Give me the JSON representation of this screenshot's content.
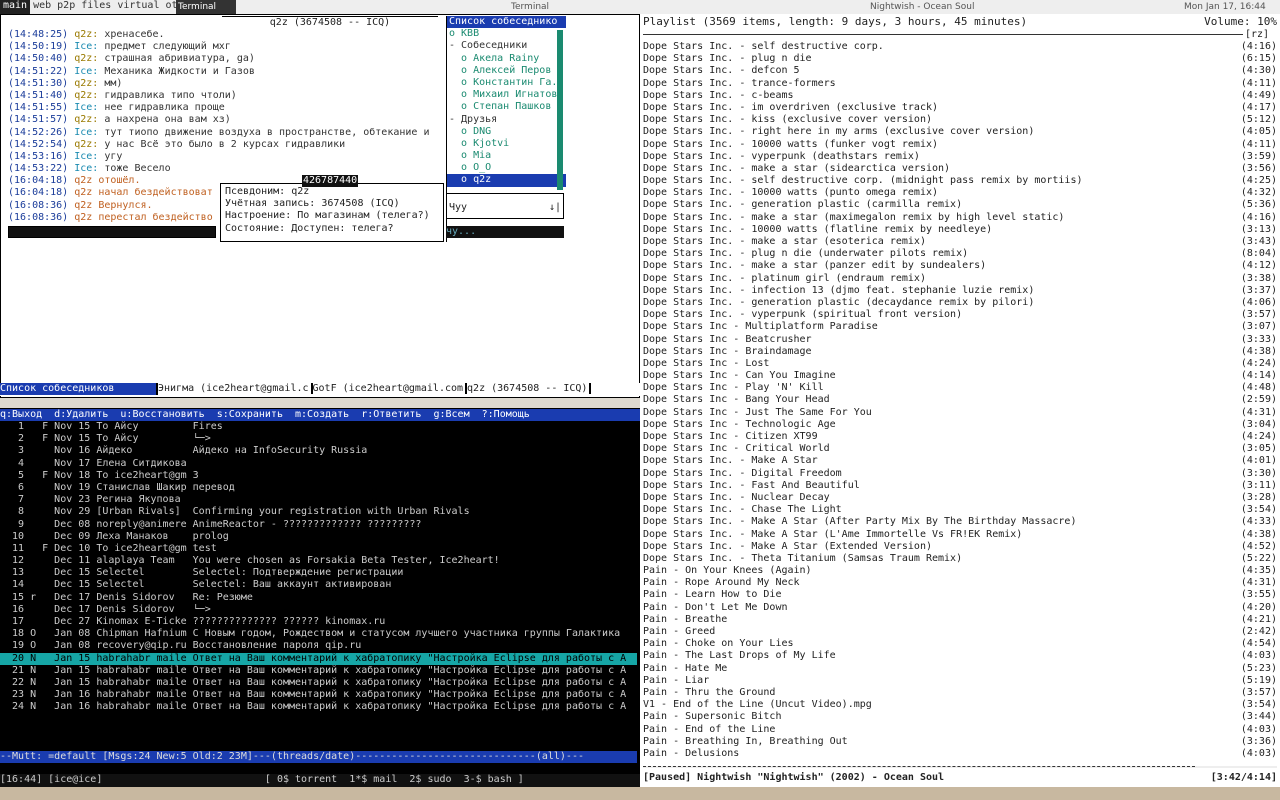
{
  "topbar": {
    "tags": [
      "main",
      "web",
      "p2p",
      "files",
      "virtual",
      "other"
    ],
    "selected_tag": "main",
    "left_window": "Terminal",
    "mid_window": "Terminal",
    "right_window": "Nightwish - Ocean Soul",
    "clock": "Mon Jan 17, 16:44"
  },
  "im": {
    "window_title": "q2z (3674508 -- ICQ)",
    "messages": [
      {
        "time": "(14:48:25)",
        "nick": "q2z:",
        "text": " хренасебе.",
        "type": "q2z"
      },
      {
        "time": "(14:50:19)",
        "nick": "Ice:",
        "text": " предмет следующий мхг",
        "type": "ice"
      },
      {
        "time": "(14:50:40)",
        "nick": "q2z:",
        "text": " страшная абривиатура, ga)",
        "type": "q2z"
      },
      {
        "time": "(14:51:22)",
        "nick": "Ice:",
        "text": " Механика Жидкости и Газов",
        "type": "ice"
      },
      {
        "time": "(14:51:30)",
        "nick": "q2z:",
        "text": " мм)",
        "type": "q2z"
      },
      {
        "time": "(14:51:40)",
        "nick": "q2z:",
        "text": " гидравлика типо чтоли)",
        "type": "q2z"
      },
      {
        "time": "(14:51:55)",
        "nick": "Ice:",
        "text": " нее гидравлика проще",
        "type": "ice"
      },
      {
        "time": "(14:51:57)",
        "nick": "q2z:",
        "text": " а нахрена она вам хз)",
        "type": "q2z"
      },
      {
        "time": "(14:52:26)",
        "nick": "Ice:",
        "text": " тут тиопо движение воздуха в пространстве, обтекание и",
        "type": "ice"
      },
      {
        "time": "(14:52:54)",
        "nick": "q2z:",
        "text": " у нас Всё это было в 2 курсах гидравлики",
        "type": "q2z"
      },
      {
        "time": "(14:53:16)",
        "nick": "Ice:",
        "text": " угу",
        "type": "ice"
      },
      {
        "time": "(14:53:22)",
        "nick": "Ice:",
        "text": " тоже Весело",
        "type": "ice"
      },
      {
        "time": "(16:04:18)",
        "nick": "q2z",
        "text": " отошёл.",
        "type": "orng"
      },
      {
        "time": "(16:04:18)",
        "nick": "q2z",
        "text": " начал бездействоват",
        "type": "orng"
      },
      {
        "time": "(16:08:36)",
        "nick": "q2z",
        "text": " Вернулся.",
        "type": "orng"
      },
      {
        "time": "(16:08:36)",
        "nick": "q2z",
        "text": " перестал бездейство",
        "type": "orng"
      }
    ],
    "roster": {
      "header": "Список собеседнико",
      "items": [
        {
          "text": "o KBB",
          "kind": "cont"
        },
        {
          "text": "- Собеседники",
          "kind": "grp"
        },
        {
          "text": "  o Акела Rainy",
          "kind": "cont"
        },
        {
          "text": "  o Алексей Перов",
          "kind": "cont"
        },
        {
          "text": "  o Константин Га.",
          "kind": "cont"
        },
        {
          "text": "  o Михаил Игнатов",
          "kind": "cont"
        },
        {
          "text": "  o Степан Пашков",
          "kind": "cont"
        },
        {
          "text": "- Друзья",
          "kind": "grp"
        },
        {
          "text": "  o DNG",
          "kind": "cont"
        },
        {
          "text": "  o Kjotvi",
          "kind": "cont"
        },
        {
          "text": "  o Mia",
          "kind": "cont"
        },
        {
          "text": "  o O_O",
          "kind": "cont"
        },
        {
          "text": "  o q2z",
          "kind": "sel"
        }
      ]
    },
    "tooltip": {
      "title": "426787440",
      "lines": [
        "Псевдоним: q2z",
        "Учётная запись: 3674508 (ICQ)",
        "Настроение: По магазинам (телега?)",
        "Состояние: Доступен: телега?"
      ]
    },
    "input_text": "Чуу",
    "input_arrow": "↓|",
    "input_line": "чу...",
    "status_segments": [
      "Список собеседников",
      "Энигма (ice2heart@gmail.c",
      "GotF (ice2heart@gmail.com",
      "q2z (3674508 -- ICQ)"
    ]
  },
  "mutt": {
    "help": "q:Выход  d:Удалить  u:Восстановить  s:Сохранить  m:Создать  r:Ответить  g:Всем  ?:Помощь",
    "rows": [
      "   1   F Nov 15 To Айсу         Fires",
      "   2   F Nov 15 To Айсу         └─>",
      "   3     Nov 16 Айдеко          Айдеко на InfoSecurity Russia",
      "   4     Nov 17 Елена Ситдикова",
      "   5   F Nov 18 To ice2heart@gm 3",
      "   6     Nov 19 Станислав Шакир перевод",
      "   7     Nov 23 Регина Якупова",
      "   8     Nov 29 [Urban Rivals]  Confirming your registration with Urban Rivals",
      "   9     Dec 08 noreply@animere AnimeReactor - ????????????? ?????????",
      "  10     Dec 09 Леха Манаков    prolog",
      "  11   F Dec 10 To ice2heart@gm test",
      "  12     Dec 11 alaplaya Team   You were chosen as Forsakia Beta Tester, Ice2heart!",
      "  13     Dec 15 Selectel        Selectel: Подтверждение регистрации",
      "  14     Dec 15 Selectel        Selectel: Ваш аккаунт активирован",
      "  15 r   Dec 17 Denis Sidorov   Re: Резюме",
      "  16     Dec 17 Denis Sidorov   └─>",
      "  17     Dec 27 Kinomax E-Ticke ?????????????? ?????? kinomax.ru",
      "  18 O   Jan 08 Chipman Hafnium С Новым годом, Рождеством и статусом лучшего участника группы Галактика",
      "  19 O   Jan 08 recovery@qip.ru Восстановление пароля qip.ru",
      "  20 N   Jan 15 habrahabr maile Ответ на Ваш комментарий к хабратопику \"Настройка Eclipse для работы с A",
      "  21 N   Jan 15 habrahabr maile Ответ на Ваш комментарий к хабратопику \"Настройка Eclipse для работы с A",
      "  22 N   Jan 15 habrahabr maile Ответ на Ваш комментарий к хабратопику \"Настройка Eclipse для работы с A",
      "  23 N   Jan 16 habrahabr maile Ответ на Ваш комментарий к хабратопику \"Настройка Eclipse для работы с A",
      "  24 N   Jan 16 habrahabr maile Ответ на Ваш комментарий к хабратопику \"Настройка Eclipse для работы с A"
    ],
    "current_row": 19,
    "status": "--Mutt: =default [Msgs:24 New:5 Old:2 23M]---(threads/date)------------------------------(all)---",
    "screenbar": "[16:44] [ice@ice]                           [ 0$ torrent  1*$ mail  2$ sudo  3-$ bash ]"
  },
  "playlist": {
    "header": "Playlist (3569 items, length: 9 days, 3 hours, 45 minutes)",
    "volume": "Volume: 10%",
    "corner": "[rz]",
    "tracks": [
      [
        "Dope Stars Inc. - self destructive corp.",
        "(4:16)"
      ],
      [
        "Dope Stars Inc. - plug n die",
        "(6:15)"
      ],
      [
        "Dope Stars Inc. - defcon 5",
        "(4:30)"
      ],
      [
        "Dope Stars Inc. - trance-formers",
        "(4:11)"
      ],
      [
        "Dope Stars Inc. - c-beams",
        "(4:49)"
      ],
      [
        "Dope Stars Inc. - im overdriven (exclusive track)",
        "(4:17)"
      ],
      [
        "Dope Stars Inc. - kiss (exclusive cover version)",
        "(5:12)"
      ],
      [
        "Dope Stars Inc. - right here in my arms (exclusive cover version)",
        "(4:05)"
      ],
      [
        "Dope Stars Inc. - 10000 watts (funker vogt remix)",
        "(4:11)"
      ],
      [
        "Dope Stars Inc. - vyperpunk (deathstars remix)",
        "(3:59)"
      ],
      [
        "Dope Stars Inc. - make a star (sidearctica version)",
        "(3:56)"
      ],
      [
        "Dope Stars Inc. - self destructive corp. (midnight pass remix by mortiis)",
        "(4:25)"
      ],
      [
        "Dope Stars Inc. - 10000 watts (punto omega remix)",
        "(4:32)"
      ],
      [
        "Dope Stars Inc. - generation plastic (carmilla remix)",
        "(5:36)"
      ],
      [
        "Dope Stars Inc. - make a star (maximegalon remix by high level static)",
        "(4:16)"
      ],
      [
        "Dope Stars Inc. - 10000 watts (flatline remix by needleye)",
        "(3:13)"
      ],
      [
        "Dope Stars Inc. - make a star (esoterica remix)",
        "(3:43)"
      ],
      [
        "Dope Stars Inc. - plug n die (underwater pilots remix)",
        "(8:04)"
      ],
      [
        "Dope Stars Inc. - make a star (panzer edit by sundealers)",
        "(4:12)"
      ],
      [
        "Dope Stars Inc. - platinum girl (endraum remix)",
        "(3:38)"
      ],
      [
        "Dope Stars Inc. - infection 13 (djmo feat. stephanie luzie remix)",
        "(3:37)"
      ],
      [
        "Dope Stars Inc. - generation plastic (decaydance remix by pilori)",
        "(4:06)"
      ],
      [
        "Dope Stars Inc. - vyperpunk (spiritual front version)",
        "(3:57)"
      ],
      [
        "Dope Stars Inc - Multiplatform Paradise",
        "(3:07)"
      ],
      [
        "Dope Stars Inc - Beatcrusher",
        "(3:33)"
      ],
      [
        "Dope Stars Inc - Braindamage",
        "(4:38)"
      ],
      [
        "Dope Stars Inc - Lost",
        "(4:24)"
      ],
      [
        "Dope Stars Inc - Can You Imagine",
        "(4:14)"
      ],
      [
        "Dope Stars Inc - Play 'N' Kill",
        "(4:48)"
      ],
      [
        "Dope Stars Inc - Bang Your Head",
        "(2:59)"
      ],
      [
        "Dope Stars Inc - Just The Same For You",
        "(4:31)"
      ],
      [
        "Dope Stars Inc - Technologic Age",
        "(3:04)"
      ],
      [
        "Dope Stars Inc - Citizen XT99",
        "(4:24)"
      ],
      [
        "Dope Stars Inc - Critical World",
        "(3:05)"
      ],
      [
        "Dope Stars Inc. - Make A Star",
        "(4:01)"
      ],
      [
        "Dope Stars Inc. - Digital Freedom",
        "(3:30)"
      ],
      [
        "Dope Stars Inc. - Fast And Beautiful",
        "(3:11)"
      ],
      [
        "Dope Stars Inc. - Nuclear Decay",
        "(3:28)"
      ],
      [
        "Dope Stars Inc. - Chase The Light",
        "(3:54)"
      ],
      [
        "Dope Stars Inc. - Make A Star (After Party Mix By The Birthday Massacre)",
        "(4:33)"
      ],
      [
        "Dope Stars Inc. - Make A Star (L'Ame Immortelle Vs FR!EK Remix)",
        "(4:38)"
      ],
      [
        "Dope Stars Inc. - Make A Star (Extended Version)",
        "(4:52)"
      ],
      [
        "Dope Stars Inc. - Theta Titanium (Samsas Traum Remix)",
        "(5:22)"
      ],
      [
        "Pain - On Your Knees (Again)",
        "(4:35)"
      ],
      [
        "Pain - Rope Around My Neck",
        "(4:31)"
      ],
      [
        "Pain - Learn How to Die",
        "(3:55)"
      ],
      [
        "Pain - Don't Let Me Down",
        "(4:20)"
      ],
      [
        "Pain - Breathe",
        "(4:21)"
      ],
      [
        "Pain - Greed",
        "(2:42)"
      ],
      [
        "Pain - Choke on Your Lies",
        "(4:54)"
      ],
      [
        "Pain - The Last Drops of My Life",
        "(4:03)"
      ],
      [
        "Pain - Hate Me",
        "(5:23)"
      ],
      [
        "Pain - Liar",
        "(5:19)"
      ],
      [
        "Pain - Thru the Ground",
        "(3:57)"
      ],
      [
        "V1 - End of the Line (Uncut Video).mpg",
        "(3:54)"
      ],
      [
        "Pain - Supersonic Bitch",
        "(3:44)"
      ],
      [
        "Pain - End of the Line",
        "(4:03)"
      ],
      [
        "Pain - Breathing In, Breathing Out",
        "(3:36)"
      ],
      [
        "Pain - Delusions",
        "(4:03)"
      ]
    ],
    "footer_left": "[Paused] Nightwish \"Nightwish\" (2002) - Ocean Soul",
    "footer_right": "[3:42/4:14]",
    "progress": 0.87
  }
}
